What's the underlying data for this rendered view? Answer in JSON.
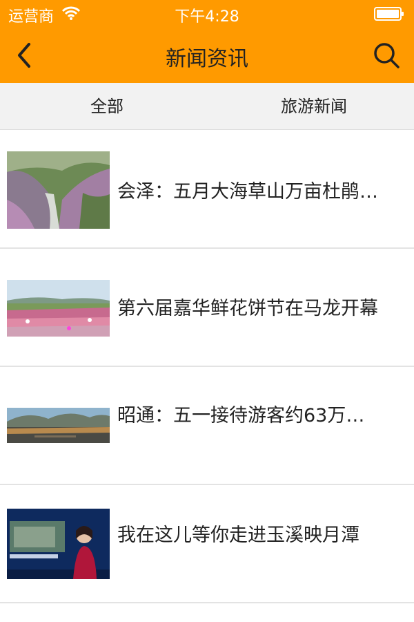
{
  "status_bar": {
    "carrier": "运营商",
    "time": "下午4:28"
  },
  "header": {
    "title": "新闻资讯"
  },
  "tabs": [
    {
      "label": "全部"
    },
    {
      "label": "旅游新闻"
    }
  ],
  "news": [
    {
      "title": "会泽：五月大海草山万亩杜鹃…"
    },
    {
      "title": "第六届嘉华鲜花饼节在马龙开幕"
    },
    {
      "title": "昭通：五一接待游客约63万…"
    },
    {
      "title": "我在这儿等你走进玉溪映月潭"
    }
  ],
  "colors": {
    "accent": "#ff9a00",
    "tab_bg": "#f2f2f2",
    "divider": "#e3e3e3"
  }
}
